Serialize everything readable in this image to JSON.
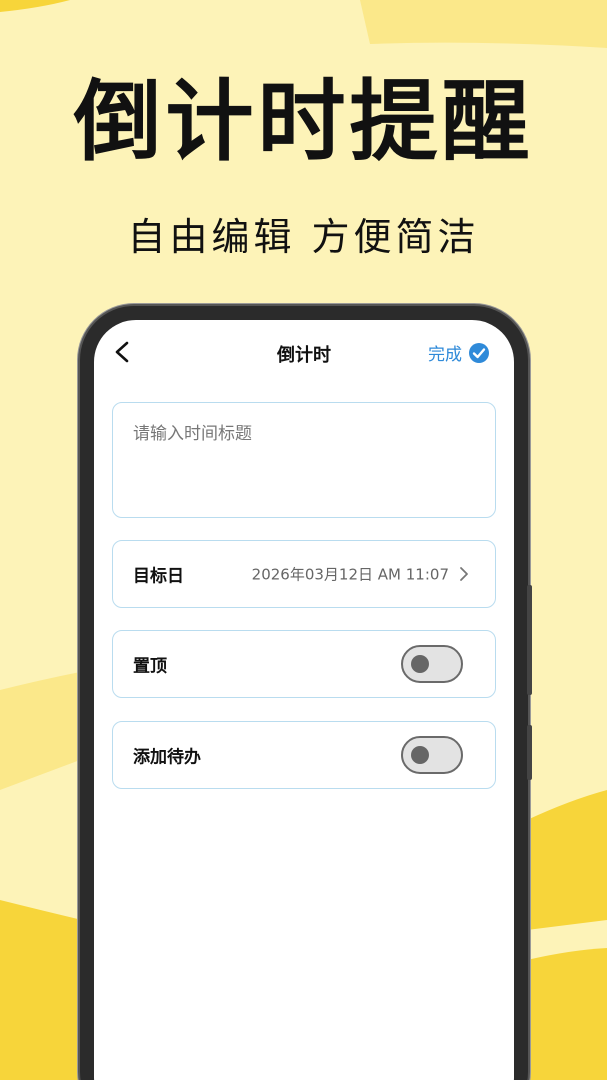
{
  "promo": {
    "title": "倒计时提醒",
    "subtitle": "自由编辑 方便简洁"
  },
  "colors": {
    "background": "#fdf3b8",
    "accent_yellow": "#f7d53a",
    "link_blue": "#2f8ad9",
    "card_border": "#b9dcef"
  },
  "app": {
    "nav": {
      "back_icon": "chevron-left-icon",
      "title": "倒计时",
      "done_label": "完成",
      "done_icon": "check-circle-icon"
    },
    "title_field": {
      "placeholder": "请输入时间标题",
      "value": ""
    },
    "target_date": {
      "label": "目标日",
      "value": "2026年03月12日 AM 11:07",
      "icon": "chevron-right-icon"
    },
    "pin_top": {
      "label": "置顶",
      "on": false
    },
    "add_todo": {
      "label": "添加待办",
      "on": false
    }
  }
}
